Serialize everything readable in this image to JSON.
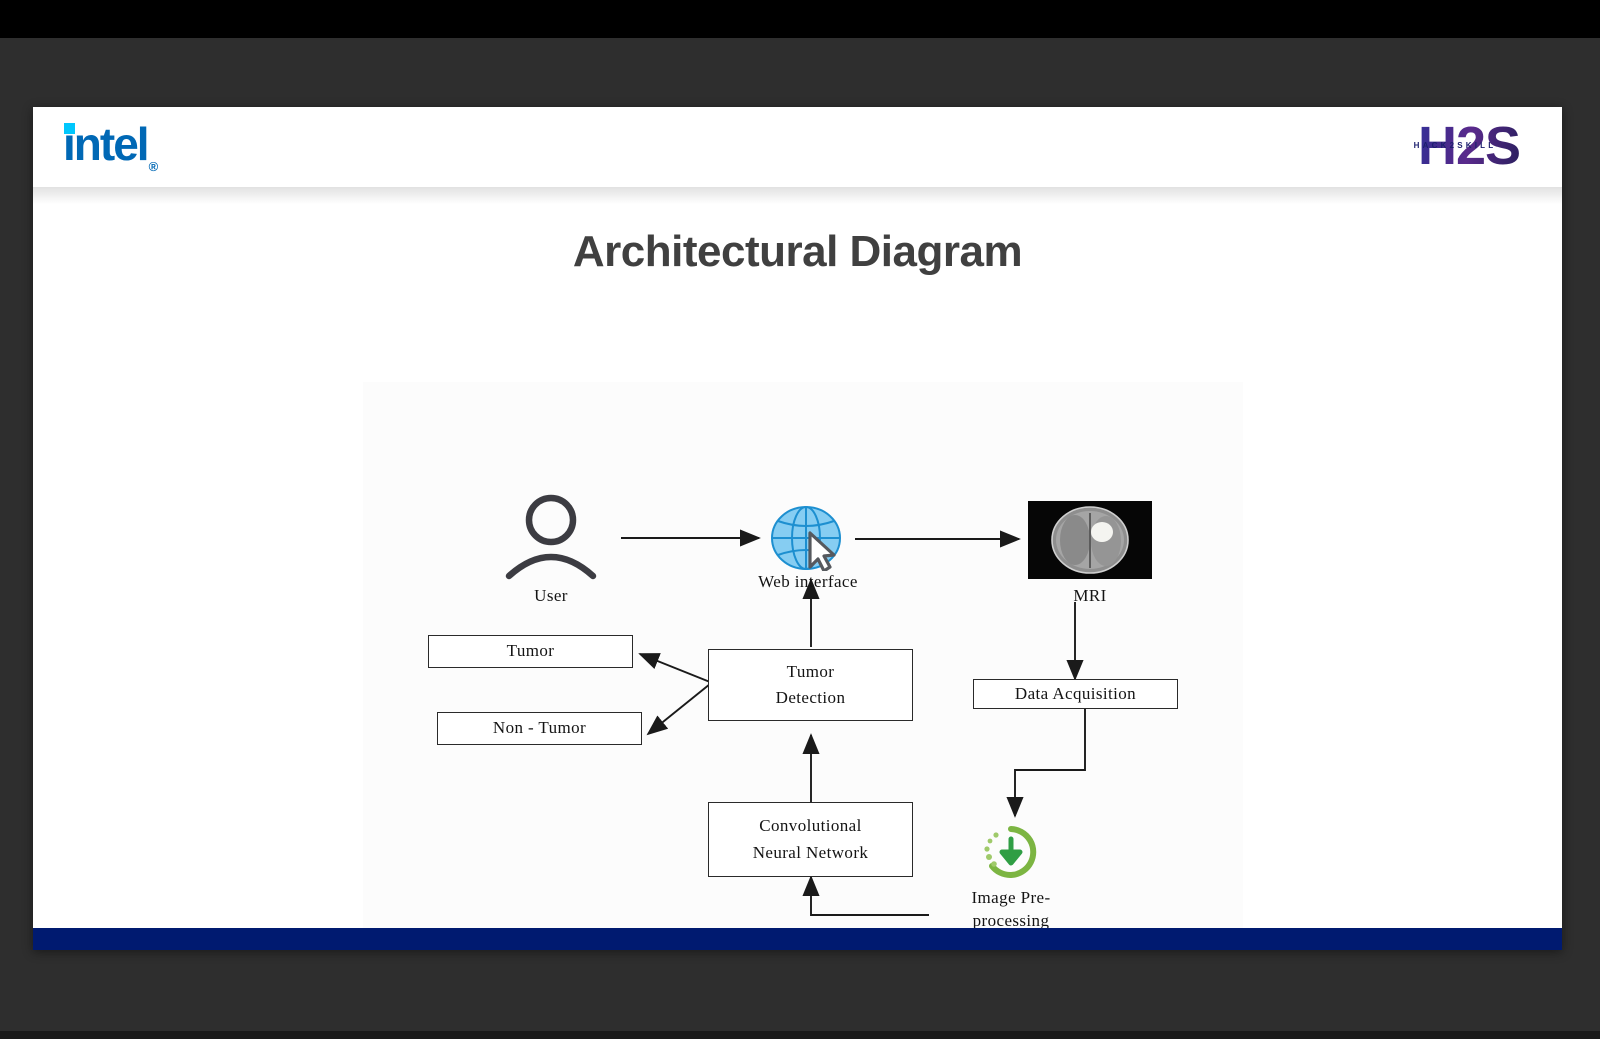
{
  "window": {
    "backdrop_color": "#2e2e2e",
    "top_bar_color": "#000000"
  },
  "slide": {
    "background_color": "#ffffff",
    "footer_bar_color": "#001a70",
    "title": "Architectural Diagram",
    "title_color": "#404040",
    "header": {
      "brand_left": {
        "name": "intel-logo",
        "text": "intel",
        "registered_mark": "®",
        "color": "#0068b5",
        "accent_color": "#00c7fd"
      },
      "brand_right": {
        "name": "h2s-logo",
        "text": "H2S",
        "subtext": "HACK2SKILL",
        "color": "#2b2a80"
      }
    }
  },
  "diagram": {
    "type": "flowchart",
    "nodes": [
      {
        "id": "user",
        "label": "User",
        "kind": "icon",
        "icon": "user-icon"
      },
      {
        "id": "web",
        "label": "Web interface",
        "kind": "icon",
        "icon": "globe-icon"
      },
      {
        "id": "mri",
        "label": "MRI",
        "kind": "image",
        "icon": "mri-scan-image"
      },
      {
        "id": "data_acq",
        "label": "Data Acquisition",
        "kind": "box"
      },
      {
        "id": "preproc",
        "label_line1": "Image Pre-",
        "label_line2": "processing",
        "kind": "icon",
        "icon": "download-progress-icon",
        "icon_color": "#5aa82e"
      },
      {
        "id": "cnn",
        "label_line1": "Convolutional",
        "label_line2": "Neural Network",
        "kind": "box"
      },
      {
        "id": "tumor_detect",
        "label_line1": "Tumor",
        "label_line2": "Detection",
        "kind": "box"
      },
      {
        "id": "tumor",
        "label": "Tumor",
        "kind": "box"
      },
      {
        "id": "non_tumor",
        "label": "Non - Tumor",
        "kind": "box"
      }
    ],
    "edges": [
      {
        "from": "user",
        "to": "web"
      },
      {
        "from": "web",
        "to": "mri"
      },
      {
        "from": "mri",
        "to": "data_acq"
      },
      {
        "from": "data_acq",
        "to": "preproc"
      },
      {
        "from": "preproc",
        "to": "cnn"
      },
      {
        "from": "cnn",
        "to": "tumor_detect"
      },
      {
        "from": "tumor_detect",
        "to": "web"
      },
      {
        "from": "tumor_detect",
        "to": "tumor"
      },
      {
        "from": "tumor_detect",
        "to": "non_tumor"
      }
    ]
  }
}
